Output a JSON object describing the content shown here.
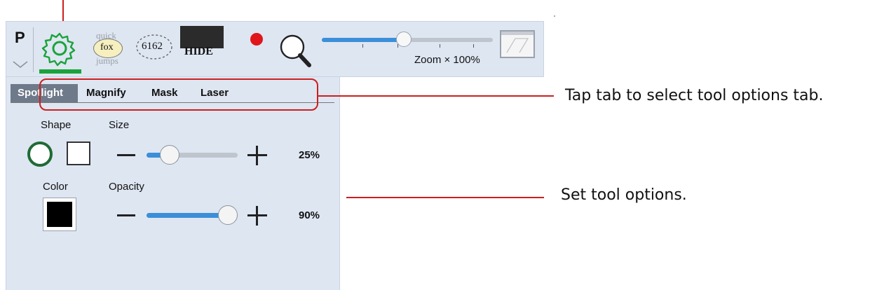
{
  "toolbar": {
    "profile_label": "P",
    "stamp_words": [
      "quick",
      "fox",
      "jumps"
    ],
    "counter_value": "6162",
    "hide_label": "HIDE",
    "zoom_label": "Zoom × 100%",
    "zoom_fraction": 0.48
  },
  "tabs": {
    "items": [
      "Spotlight",
      "Magnify",
      "Mask",
      "Laser"
    ],
    "active": "Spotlight"
  },
  "options": {
    "shape_label": "Shape",
    "size_label": "Size",
    "size_value": "25%",
    "size_fraction": 0.25,
    "color_label": "Color",
    "opacity_label": "Opacity",
    "opacity_value": "90%",
    "opacity_fraction": 0.9,
    "selected_color": "#000000"
  },
  "annotations": {
    "tab_note": "Tap tab to select tool options tab.",
    "options_note": "Set tool options."
  },
  "colors": {
    "accent_blue": "#3b8fd8",
    "highlight_green": "#1aa33a",
    "annotation_red": "#cc1f1f",
    "record_red": "#e0161b"
  }
}
